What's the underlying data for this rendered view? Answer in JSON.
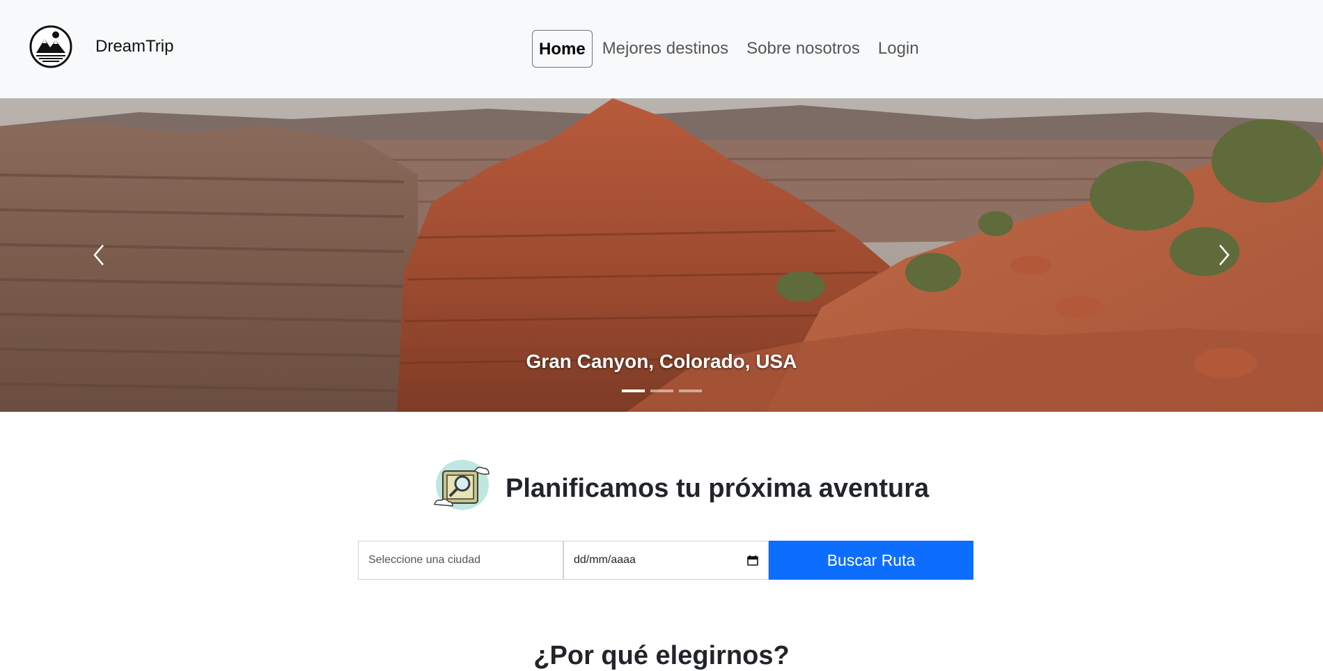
{
  "navbar": {
    "brand": "DreamTrip",
    "links": [
      "Home",
      "Mejores destinos",
      "Sobre nosotros",
      "Login"
    ]
  },
  "carousel": {
    "caption": "Gran Canyon, Colorado, USA",
    "slide_count": 3,
    "active_slide": 1
  },
  "planner": {
    "title": "Planificamos tu próxima aventura",
    "city_placeholder": "Seleccione una ciudad",
    "date_placeholder": "dd/mm/aaaa",
    "search_label": "Buscar Ruta"
  },
  "section": {
    "title": "¿Por qué elegirnos?"
  },
  "colors": {
    "primary": "#0d6efd",
    "navbar_bg": "#f8f9fa"
  },
  "icons": [
    "mountain-logo-icon",
    "chevron-left-icon",
    "chevron-right-icon",
    "map-search-icon",
    "calendar-icon"
  ]
}
